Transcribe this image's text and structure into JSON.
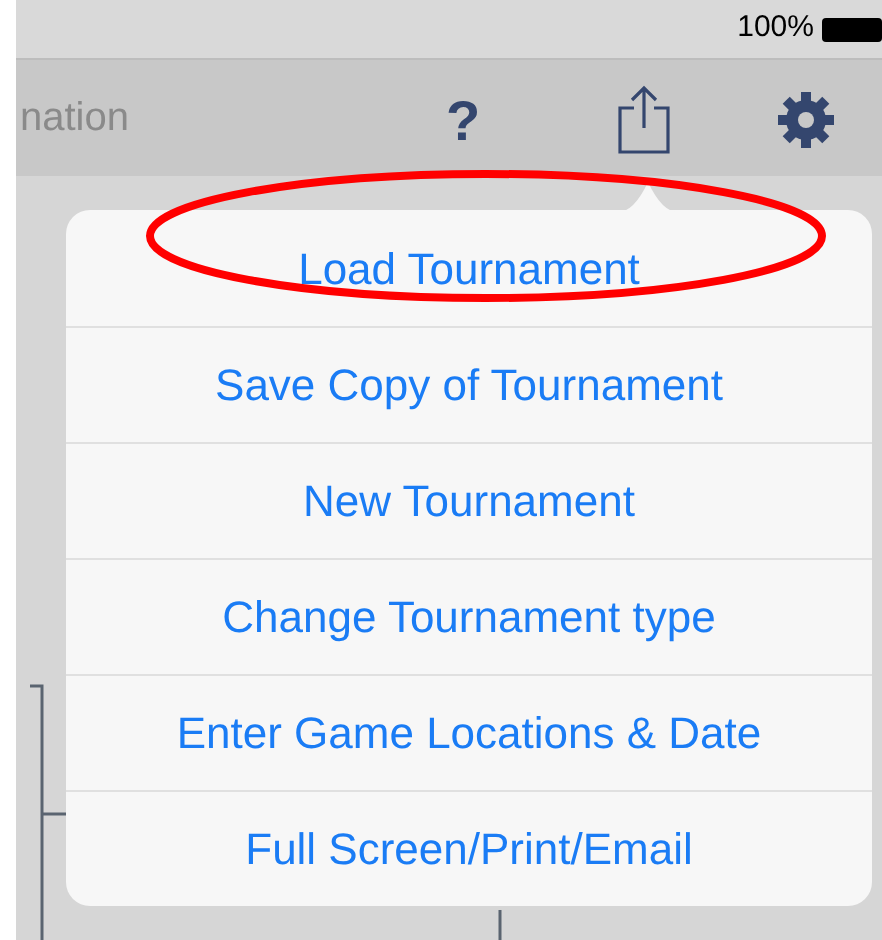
{
  "status_bar": {
    "battery": "100%"
  },
  "nav_bar": {
    "title": "nation",
    "help": "?"
  },
  "menu": [
    {
      "label": "Load Tournament",
      "circled": true
    },
    {
      "label": "Save Copy of Tournament",
      "circled": false
    },
    {
      "label": "New Tournament",
      "circled": false
    },
    {
      "label": "Change Tournament type",
      "circled": false
    },
    {
      "label": "Enter Game Locations & Date",
      "circled": false
    },
    {
      "label": "Full Screen/Print/Email",
      "circled": false
    }
  ]
}
